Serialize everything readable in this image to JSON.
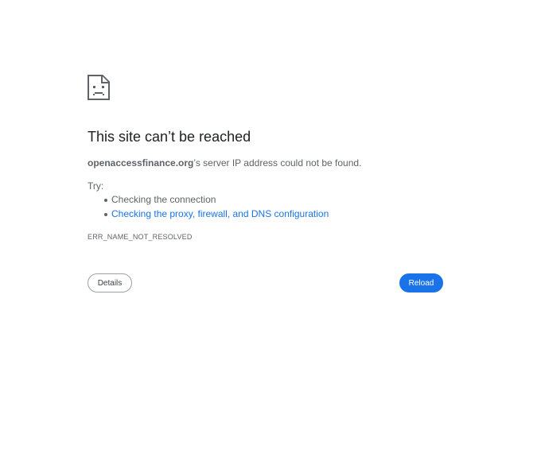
{
  "error_icon": "sad-page-icon",
  "title": "This site can’t be reached",
  "summary": {
    "host": "openaccessfinance.org",
    "message": "’s server IP address could not be found."
  },
  "try_label": "Try:",
  "suggestions": [
    {
      "text": "Checking the connection",
      "is_link": false
    },
    {
      "text": "Checking the proxy, firewall, and DNS configuration",
      "is_link": true
    }
  ],
  "error_code": "ERR_NAME_NOT_RESOLVED",
  "buttons": {
    "details": "Details",
    "reload": "Reload"
  },
  "colors": {
    "link": "#1a73e8",
    "primary_button": "#1a73e8",
    "text_secondary": "#5f6368"
  }
}
